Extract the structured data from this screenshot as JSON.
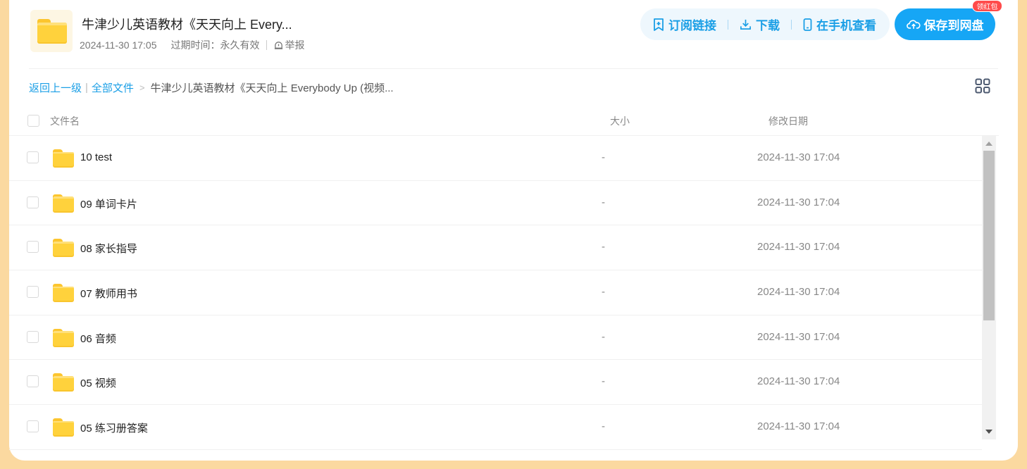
{
  "header": {
    "title": "牛津少儿英语教材《天天向上 Every...",
    "date": "2024-11-30 17:05",
    "expire_text": "过期时间：永久有效",
    "report_label": "举报",
    "subscribe_label": "订阅链接",
    "download_label": "下载",
    "phone_label": "在手机查看",
    "save_label": "保存到网盘",
    "badge_label": "领红包"
  },
  "breadcrumb": {
    "back_label": "返回上一级",
    "all_files_label": "全部文件",
    "separator": ">",
    "current": "牛津少儿英语教材《天天向上 Everybody Up (视频..."
  },
  "table": {
    "col_name": "文件名",
    "col_size": "大小",
    "col_date": "修改日期",
    "rows": [
      {
        "name": "10 test",
        "size": "-",
        "date": "2024-11-30 17:04"
      },
      {
        "name": "09 单词卡片",
        "size": "-",
        "date": "2024-11-30 17:04"
      },
      {
        "name": "08 家长指导",
        "size": "-",
        "date": "2024-11-30 17:04"
      },
      {
        "name": "07 教师用书",
        "size": "-",
        "date": "2024-11-30 17:04"
      },
      {
        "name": "06 音频",
        "size": "-",
        "date": "2024-11-30 17:04"
      },
      {
        "name": "05 视频",
        "size": "-",
        "date": "2024-11-30 17:04"
      },
      {
        "name": "05 练习册答案",
        "size": "-",
        "date": "2024-11-30 17:04"
      }
    ]
  },
  "icons": {
    "folder": "folder-icon",
    "report": "alert-bell-icon",
    "subscribe": "bookmark-plus-icon",
    "download": "download-icon",
    "phone": "mobile-phone-icon",
    "save": "cloud-upload-icon",
    "view_toggle": "grid-view-icon"
  },
  "colors": {
    "accent": "#16a6f5",
    "link": "#1b9fe6",
    "page_bg": "#fbd9a0",
    "badge": "#ff4b4b",
    "folder": "#ffd23c"
  }
}
